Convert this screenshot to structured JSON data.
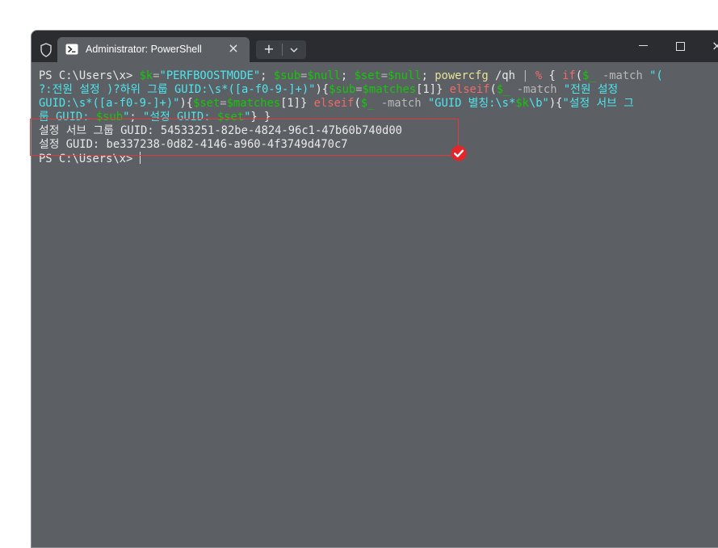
{
  "window": {
    "tab_title": "Administrator: PowerShell",
    "tab_icon": "powershell-icon",
    "new_tab_label": "+",
    "close_glyph": "×"
  },
  "terminal": {
    "prompt1": "PS C:\\Users\\x> ",
    "cmd": {
      "a1": "$k",
      "a2": "=",
      "a3": "\"PERFBOOSTMODE\"",
      "a4": "; ",
      "a5": "$sub",
      "a6": "=",
      "a7": "$null",
      "a8": "; ",
      "a9": "$set",
      "a10": "=",
      "a11": "$null",
      "a12": "; ",
      "a13": "powercfg",
      "a14": " /qh ",
      "a15": "|",
      "a16": " ",
      "a17": "%",
      "a18": " { ",
      "a19": "if",
      "a20": "(",
      "a21": "$_",
      "a22": " -match ",
      "a23": "\"(",
      "b1": "?:전원 설정 )?하위 그룹 GUID:\\s*([a-f0-9-]+)\"",
      "b2": "){",
      "b3": "$sub",
      "b4": "=",
      "b5": "$matches",
      "b6": "[1]} ",
      "b7": "elseif",
      "b8": "(",
      "b9": "$_",
      "b10": " -match ",
      "b11": "\"전원 설정",
      "c1": "GUID:\\s*([a-f0-9-]+)\"",
      "c2": "){",
      "c3": "$set",
      "c4": "=",
      "c5": "$matches",
      "c6": "[1]} ",
      "c7": "elseif",
      "c8": "(",
      "c9": "$_",
      "c10": " -match ",
      "c11": "\"GUID 별칭:\\s*",
      "c12": "$k",
      "c13": "\\b\"",
      "c14": "){",
      "c15": "\"설정 서브 그",
      "d1": "룹 GUID: ",
      "d2": "$sub",
      "d3": "\"",
      "d4": "; ",
      "d5": "\"설정 GUID: ",
      "d6": "$set",
      "d7": "\"",
      "d8": "} }"
    },
    "output": [
      "설정 서브 그룹 GUID: 54533251-82be-4824-96c1-47b60b740d00",
      "설정 GUID: be337238-0d82-4146-a960-4f3749d470c7"
    ],
    "prompt2": "PS C:\\Users\\x> "
  },
  "colors": {
    "background": "#5c5f63",
    "titlebar": "#2a2c2f",
    "highlight": "#e23a3a",
    "check": "#e5252a"
  }
}
